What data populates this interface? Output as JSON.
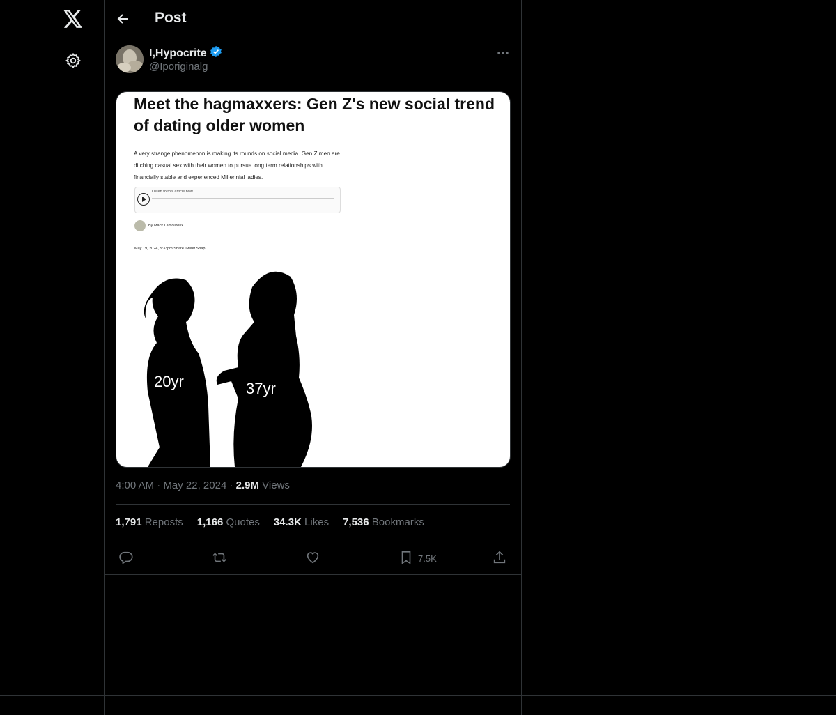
{
  "header": {
    "title": "Post"
  },
  "author": {
    "name": "I,Hypocrite",
    "handle": "@Iporiginalg",
    "verified": true
  },
  "media": {
    "headline": "Meet the hagmaxxers: Gen Z's new social trend of dating older women",
    "dek": "A very strange phenomenon is making its rounds on social media. Gen Z men are ditching casual sex with their women to pursue long term relationships with financially stable and experienced Millennial ladies.",
    "audio_label": "Listen to this article now",
    "byline": "By Mack Lamoureux",
    "dateline": "May 19, 2024, 5:33pm  Share  Tweet  Snap",
    "left_label": "20yr",
    "right_label": "37yr"
  },
  "meta": {
    "time": "4:00 AM",
    "date": "May 22, 2024",
    "views_count": "2.9M",
    "views_label": "Views",
    "sep": "·"
  },
  "stats": {
    "reposts_count": "1,791",
    "reposts_label": "Reposts",
    "quotes_count": "1,166",
    "quotes_label": "Quotes",
    "likes_count": "34.3K",
    "likes_label": "Likes",
    "bookmarks_count": "7,536",
    "bookmarks_label": "Bookmarks"
  },
  "actions": {
    "bookmark_count": "7.5K"
  },
  "icons": [
    "x-logo-icon",
    "gear-icon",
    "back-arrow-icon",
    "verified-badge-icon",
    "more-icon",
    "reply-icon",
    "repost-icon",
    "like-icon",
    "bookmark-icon",
    "share-icon"
  ],
  "colors": {
    "background": "#000000",
    "text": "#e7e9ea",
    "muted": "#71767b",
    "border": "#2f3336",
    "verified": "#1d9bf0"
  }
}
